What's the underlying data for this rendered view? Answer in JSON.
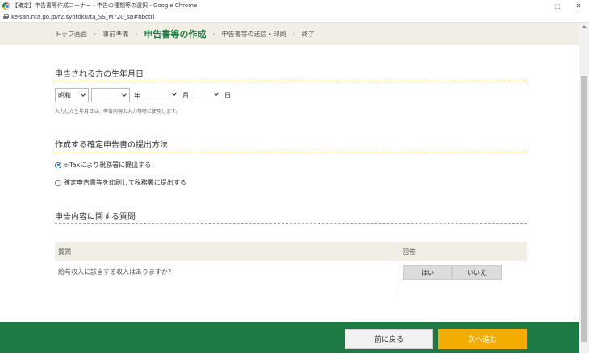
{
  "window": {
    "title": "【確定】申告書等作成コーナー - 申告の種類等の選択 - Google Chrome",
    "controls": [
      "⬚",
      "✕"
    ]
  },
  "address_bar": {
    "url": "keisan.nta.go.jp/r2/syotoku/ta_SS_M720_sp#bbctrl"
  },
  "breadcrumb": [
    "トップ画面",
    "事前準備",
    "申告書等の作成",
    "申告書等の送信・印刷",
    "終了"
  ],
  "breadcrumb_sep": "›",
  "sections": {
    "date": {
      "title": "申告される方の生年月日",
      "era_value": "昭和",
      "year_unit": "年",
      "month_unit": "月",
      "day_unit": "日",
      "note": "入力した生年月日は、申告内容の入力等時に使用します。"
    },
    "method": {
      "title": "作成する確定申告書の提出方法",
      "options": [
        "e-Taxにより税務署に提出する",
        "確定申告書等を印刷して税務署に提出する"
      ],
      "selected": 0
    },
    "questions": {
      "title": "申告内容に関する質問",
      "header_question": "質問",
      "header_answer": "回答",
      "row_question": "給与収入に該当する収入はありますか？",
      "yes_label": "はい",
      "no_label": "いいえ"
    }
  },
  "footer": {
    "back_label": "前に戻る",
    "next_label": "次へ進む"
  },
  "colors": {
    "green": "#1d7a45",
    "orange": "#f3ac00",
    "beige": "#f1efe5",
    "rule": "#c9a830"
  }
}
